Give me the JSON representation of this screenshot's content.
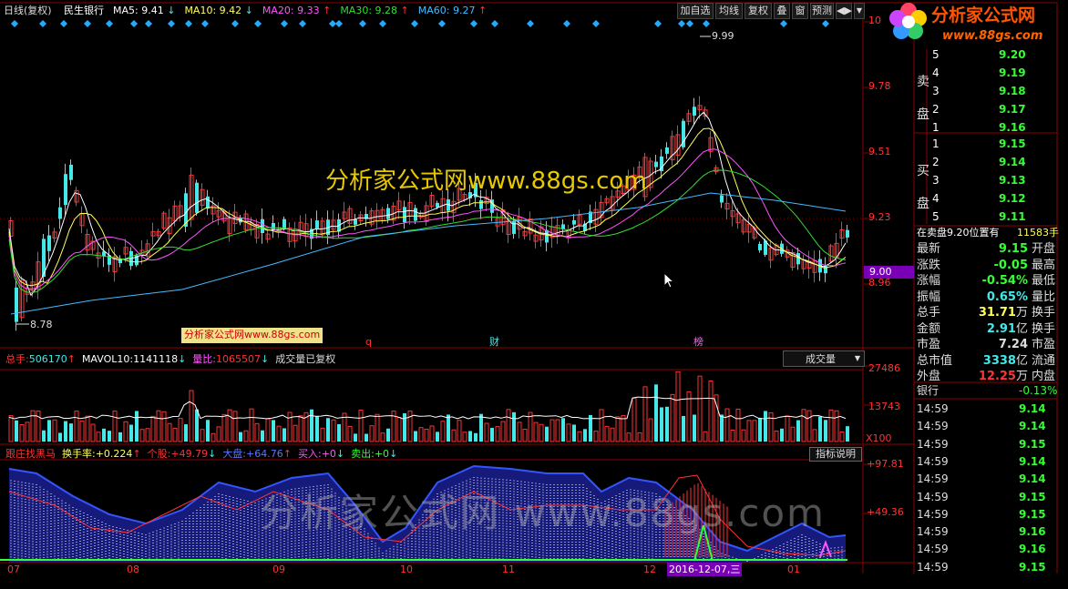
{
  "header": {
    "chart_name": "日线(复权)",
    "stock": "民生银行",
    "ma": [
      {
        "label": "MA5:",
        "value": "9.41",
        "arrow": "↓",
        "color": "#ffffff"
      },
      {
        "label": "MA10:",
        "value": "9.42",
        "arrow": "↓",
        "color": "#ffff55"
      },
      {
        "label": "MA20:",
        "value": "9.33",
        "arrow": "↑",
        "color": "#ff55ff"
      },
      {
        "label": "MA30:",
        "value": "9.28",
        "arrow": "↑",
        "color": "#33dd33"
      },
      {
        "label": "MA60:",
        "value": "9.27",
        "arrow": "↑",
        "color": "#44bbff"
      }
    ]
  },
  "toolbar": {
    "buttons": [
      "加自选",
      "均线",
      "复权",
      "叠",
      "窗",
      "预测"
    ],
    "nav_icon": "◀▶",
    "dropdown_icon": "▼"
  },
  "logo": {
    "title": "分析家公式网",
    "url": "www.88gs.com"
  },
  "watermark": {
    "main": "分析家公式网www.88gs.com",
    "lower": "分析家公式网 www.88gs.com",
    "badge": "分析家公式网www.88gs.com"
  },
  "price_axis": {
    "labels": [
      "10",
      "9.78",
      "9.51",
      "9.23",
      "8.96"
    ],
    "current": "9.00",
    "high_mark": "9.99",
    "low_mark": "8.78"
  },
  "event_markers": [
    "q",
    "财",
    "榜"
  ],
  "volume_header": {
    "total_label": "总手:",
    "total_value": "506170",
    "mavol_label": "MAVOL10:",
    "mavol_value": "1141118",
    "ratio_label": "量比:",
    "ratio_value": "1065507",
    "note": "成交量已复权",
    "selector": "成交量"
  },
  "volume_axis": {
    "labels": [
      "27486",
      "13743",
      "X100"
    ]
  },
  "indicator_header": {
    "name": "跟庄找黑马",
    "items": [
      {
        "label": "换手率:",
        "value": "+0.224",
        "arrow": "↑"
      },
      {
        "label": "个股:",
        "value": "+49.79",
        "arrow": "↓"
      },
      {
        "label": "大盘:",
        "value": "+64.76",
        "arrow": "↑"
      },
      {
        "label": "买入:",
        "value": "+0",
        "arrow": "↓"
      },
      {
        "label": "卖出:",
        "value": "+0",
        "arrow": "↓"
      }
    ],
    "explain_button": "指标说明"
  },
  "indicator_axis": {
    "labels": [
      "+97.81",
      "+49.36"
    ]
  },
  "time_axis": {
    "labels": [
      "07",
      "08",
      "09",
      "10",
      "11",
      "12",
      "01"
    ],
    "cursor_date": "2016-12-07,三"
  },
  "order_book": {
    "sell_label": [
      "卖",
      "盘"
    ],
    "buy_label": [
      "买",
      "盘"
    ],
    "sell": [
      {
        "level": "5",
        "price": "9.20"
      },
      {
        "level": "4",
        "price": "9.19"
      },
      {
        "level": "3",
        "price": "9.18"
      },
      {
        "level": "2",
        "price": "9.17"
      },
      {
        "level": "1",
        "price": "9.16"
      }
    ],
    "buy": [
      {
        "level": "1",
        "price": "9.15"
      },
      {
        "level": "2",
        "price": "9.14"
      },
      {
        "level": "3",
        "price": "9.13"
      },
      {
        "level": "4",
        "price": "9.12"
      },
      {
        "level": "5",
        "price": "9.11"
      }
    ],
    "pending_text": "在卖盘9.20位置有",
    "pending_volume": "11583手"
  },
  "quote": [
    {
      "k1": "最新",
      "v1": "9.15",
      "k2": "开盘"
    },
    {
      "k1": "涨跌",
      "v1": "-0.05",
      "k2": "最高"
    },
    {
      "k1": "涨幅",
      "v1": "-0.54%",
      "k2": "最低"
    },
    {
      "k1": "振幅",
      "v1": "0.65%",
      "k2": "量比"
    },
    {
      "k1": "总手",
      "v1": "31.71",
      "u1": "万",
      "k2": "换手"
    },
    {
      "k1": "金额",
      "v1": "2.91",
      "u1": "亿",
      "k2": "换手"
    },
    {
      "k1": "市盈",
      "v1": "7.24",
      "k2": "市盈"
    },
    {
      "k1": "总市值",
      "v1": "3338",
      "u1": "亿",
      "k2": "流通"
    },
    {
      "k1": "外盘",
      "v1": "12.25",
      "u1": "万",
      "k2": "内盘"
    }
  ],
  "sector": {
    "name": "银行",
    "change": "-0.13%"
  },
  "ticks": [
    {
      "time": "14:59",
      "price": "9.14"
    },
    {
      "time": "14:59",
      "price": "9.14"
    },
    {
      "time": "14:59",
      "price": "9.15"
    },
    {
      "time": "14:59",
      "price": "9.14"
    },
    {
      "time": "14:59",
      "price": "9.14"
    },
    {
      "time": "14:59",
      "price": "9.15"
    },
    {
      "time": "14:59",
      "price": "9.15"
    },
    {
      "time": "14:59",
      "price": "9.16"
    },
    {
      "time": "14:59",
      "price": "9.16"
    },
    {
      "time": "14:59",
      "price": "9.15"
    }
  ],
  "colors": {
    "up": "#ff3333",
    "down": "#44e8e8",
    "grid": "#8b0000",
    "bg": "#000000",
    "cyan": "#00e0ff",
    "volume_line": "#ffffff"
  }
}
